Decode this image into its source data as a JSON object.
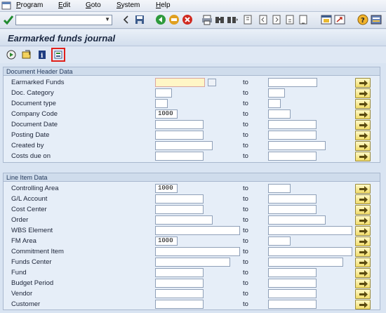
{
  "menu": {
    "items": [
      "Program",
      "Edit",
      "Goto",
      "System",
      "Help"
    ]
  },
  "toolbar": {
    "command_field_value": "",
    "icons": [
      "enter-icon",
      "save-icon",
      "back-icon",
      "exit-icon",
      "cancel-icon",
      "print-icon",
      "find-icon",
      "find-next-icon",
      "first-page-icon",
      "prev-page-icon",
      "next-page-icon",
      "last-page-icon",
      "new-session-icon",
      "shortcut-icon",
      "help-icon",
      "customize-icon"
    ]
  },
  "screen": {
    "title": "Earmarked funds journal",
    "app_icons": [
      "execute-icon",
      "get-variant-icon",
      "program-info-icon",
      "dynamic-selections-icon"
    ]
  },
  "header_group": {
    "title": "Document Header Data",
    "to_label": "to",
    "fields": [
      {
        "label": "Earmarked Funds",
        "from": "",
        "to": ""
      },
      {
        "label": "Doc. Category",
        "from": "",
        "to": ""
      },
      {
        "label": "Document type",
        "from": "",
        "to": ""
      },
      {
        "label": "Company Code",
        "from": "1000",
        "to": ""
      },
      {
        "label": "Document Date",
        "from": "",
        "to": ""
      },
      {
        "label": "Posting Date",
        "from": "",
        "to": ""
      },
      {
        "label": "Created by",
        "from": "",
        "to": ""
      },
      {
        "label": "Costs due on",
        "from": "",
        "to": ""
      }
    ]
  },
  "line_group": {
    "title": "Line Item Data",
    "to_label": "to",
    "fields": [
      {
        "label": "Controlling Area",
        "from": "1000",
        "to": ""
      },
      {
        "label": "G/L Account",
        "from": "",
        "to": ""
      },
      {
        "label": "Cost Center",
        "from": "",
        "to": ""
      },
      {
        "label": "Order",
        "from": "",
        "to": ""
      },
      {
        "label": "WBS Element",
        "from": "",
        "to": ""
      },
      {
        "label": "FM Area",
        "from": "1000",
        "to": ""
      },
      {
        "label": "Commitment Item",
        "from": "",
        "to": ""
      },
      {
        "label": "Funds Center",
        "from": "",
        "to": ""
      },
      {
        "label": "Fund",
        "from": "",
        "to": ""
      },
      {
        "label": "Budget Period",
        "from": "",
        "to": ""
      },
      {
        "label": "Vendor",
        "from": "",
        "to": ""
      },
      {
        "label": "Customer",
        "from": "",
        "to": ""
      }
    ]
  }
}
